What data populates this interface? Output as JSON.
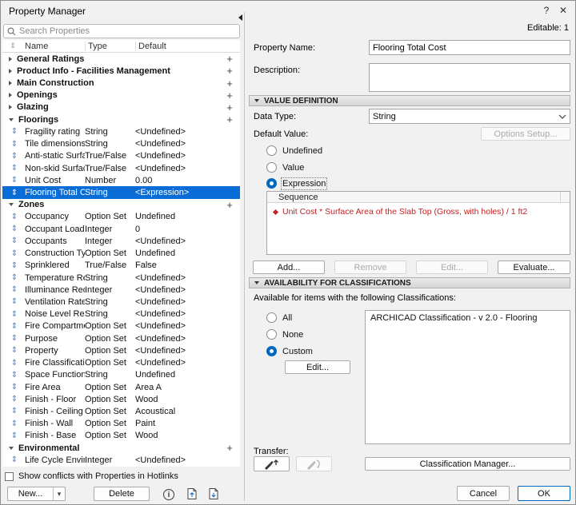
{
  "window": {
    "title": "Property Manager",
    "help": "?",
    "close": "✕"
  },
  "left": {
    "search_placeholder": "Search Properties",
    "header": {
      "name": "Name",
      "type": "Type",
      "default": "Default"
    },
    "reorder_glyph": "⇕",
    "plus_glyph": "+",
    "rows": [
      {
        "kind": "group",
        "name": "General Ratings",
        "expanded": false
      },
      {
        "kind": "group",
        "name": "Product Info - Facilities Management",
        "expanded": false
      },
      {
        "kind": "group",
        "name": "Main Construction",
        "expanded": false
      },
      {
        "kind": "group",
        "name": "Openings",
        "expanded": false
      },
      {
        "kind": "group",
        "name": "Glazing",
        "expanded": false
      },
      {
        "kind": "group",
        "name": "Floorings",
        "expanded": true
      },
      {
        "kind": "item",
        "name": "Fragility rating",
        "type": "String",
        "default": "<Undefined>"
      },
      {
        "kind": "item",
        "name": "Tile dimensions",
        "type": "String",
        "default": "<Undefined>"
      },
      {
        "kind": "item",
        "name": "Anti-static Surface",
        "type": "True/False",
        "default": "<Undefined>"
      },
      {
        "kind": "item",
        "name": "Non-skid Surface",
        "type": "True/False",
        "default": "<Undefined>"
      },
      {
        "kind": "item",
        "name": "Unit Cost",
        "type": "Number",
        "default": "0.00"
      },
      {
        "kind": "item",
        "name": "Flooring Total Cost",
        "type": "String",
        "default": "<Expression>",
        "selected": true
      },
      {
        "kind": "group",
        "name": "Zones",
        "expanded": true
      },
      {
        "kind": "item",
        "name": "Occupancy",
        "type": "Option Set",
        "default": "Undefined"
      },
      {
        "kind": "item",
        "name": "Occupant Load",
        "type": "Integer",
        "default": "0"
      },
      {
        "kind": "item",
        "name": "Occupants",
        "type": "Integer",
        "default": "<Undefined>"
      },
      {
        "kind": "item",
        "name": "Construction Types",
        "type": "Option Set",
        "default": "Undefined"
      },
      {
        "kind": "item",
        "name": "Sprinklered",
        "type": "True/False",
        "default": "False"
      },
      {
        "kind": "item",
        "name": "Temperature Req...",
        "type": "String",
        "default": "<Undefined>"
      },
      {
        "kind": "item",
        "name": "Illuminance Requ...",
        "type": "Integer",
        "default": "<Undefined>"
      },
      {
        "kind": "item",
        "name": "Ventilation Rate ...",
        "type": "String",
        "default": "<Undefined>"
      },
      {
        "kind": "item",
        "name": "Noise Level Requ...",
        "type": "String",
        "default": "<Undefined>"
      },
      {
        "kind": "item",
        "name": "Fire Compartment",
        "type": "Option Set",
        "default": "<Undefined>"
      },
      {
        "kind": "item",
        "name": "Purpose",
        "type": "Option Set",
        "default": "<Undefined>"
      },
      {
        "kind": "item",
        "name": "Property",
        "type": "Option Set",
        "default": "<Undefined>"
      },
      {
        "kind": "item",
        "name": "Fire Classification",
        "type": "Option Set",
        "default": "<Undefined>"
      },
      {
        "kind": "item",
        "name": "Space Function",
        "type": "String",
        "default": "Undefined"
      },
      {
        "kind": "item",
        "name": "Fire Area",
        "type": "Option Set",
        "default": "Area A"
      },
      {
        "kind": "item",
        "name": "Finish - Floor",
        "type": "Option Set",
        "default": "Wood"
      },
      {
        "kind": "item",
        "name": "Finish - Ceiling",
        "type": "Option Set",
        "default": "Acoustical"
      },
      {
        "kind": "item",
        "name": "Finish - Wall",
        "type": "Option Set",
        "default": "Paint"
      },
      {
        "kind": "item",
        "name": "Finish - Base",
        "type": "Option Set",
        "default": "Wood"
      },
      {
        "kind": "group",
        "name": "Environmental",
        "expanded": true
      },
      {
        "kind": "item",
        "name": "Life Cycle Environ...",
        "type": "Integer",
        "default": "<Undefined>"
      }
    ],
    "show_conflicts_label": "Show conflicts with Properties in Hotlinks",
    "new_button": "New...",
    "new_menu_arrow": "▾",
    "delete_button": "Delete"
  },
  "right": {
    "editable_badge": "Editable: 1",
    "property_name_label": "Property Name:",
    "property_name_value": "Flooring Total Cost",
    "description_label": "Description:",
    "description_value": "",
    "value_definition": {
      "header": "VALUE DEFINITION",
      "data_type_label": "Data Type:",
      "data_type_value": "String",
      "default_value_label": "Default Value:",
      "options_setup_button": "Options Setup...",
      "radio_undefined": "Undefined",
      "radio_value": "Value",
      "radio_expression": "Expression",
      "sequence_header": "Sequence",
      "expression": "Unit Cost * Surface Area of the Slab Top (Gross, with holes) / 1 ft2",
      "add_button": "Add...",
      "remove_button": "Remove",
      "edit_button": "Edit...",
      "evaluate_button": "Evaluate..."
    },
    "availability": {
      "header": "AVAILABILITY FOR CLASSIFICATIONS",
      "intro": "Available for items with the following Classifications:",
      "radio_all": "All",
      "radio_none": "None",
      "radio_custom": "Custom",
      "edit_button": "Edit...",
      "classifications": [
        "ARCHICAD Classification - v 2.0 - Flooring"
      ],
      "transfer_label": "Transfer:",
      "classification_manager_button": "Classification Manager..."
    },
    "cancel_button": "Cancel",
    "ok_button": "OK"
  }
}
